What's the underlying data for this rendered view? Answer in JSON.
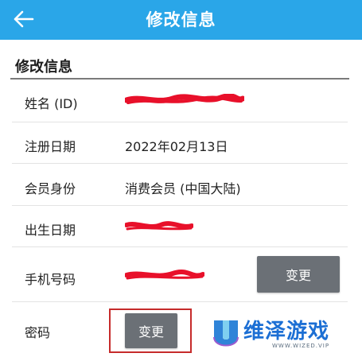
{
  "header": {
    "back_icon": "arrow-left-icon",
    "title": "修改信息"
  },
  "section": {
    "title": "修改信息"
  },
  "rows": [
    {
      "label": "姓名 (ID)",
      "value": "",
      "redacted": true
    },
    {
      "label": "注册日期",
      "value": "2022年02月13日"
    },
    {
      "label": "会员身份",
      "value": "消费会员 (中国大陆)"
    },
    {
      "label": "出生日期",
      "value": "",
      "redacted": true
    },
    {
      "label": "手机号码",
      "value": "",
      "redacted": true,
      "button": "变更"
    },
    {
      "label": "密码",
      "button": "变更"
    }
  ],
  "watermark": {
    "logo_icon": "shield-u-icon",
    "text": "维泽游戏",
    "subtext": "WWW.WIZED.VIP"
  },
  "colors": {
    "header_bg": "#2aa6e8",
    "button_bg": "#6b7076",
    "highlight": "#c62b2b",
    "redaction": "#e8102a",
    "watermark_text": "#1c6fd4"
  }
}
